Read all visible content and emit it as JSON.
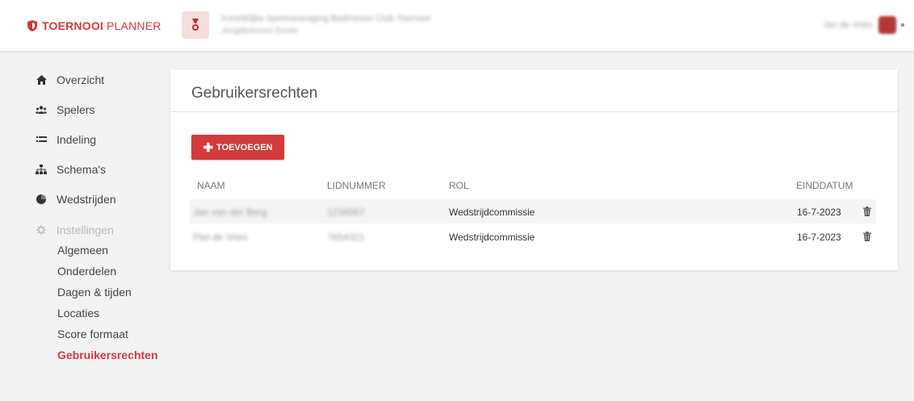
{
  "header": {
    "brand_bold": "TOERNOOI",
    "brand_light": "PLANNER",
    "org_line1": "Koninklijke Sportvereniging Badminton Club Toernooi",
    "org_line2": "Jeugdtoernooi Zomer",
    "user_name": "Jan de Vries"
  },
  "sidebar": {
    "items": [
      {
        "label": "Overzicht",
        "icon": "home-icon"
      },
      {
        "label": "Spelers",
        "icon": "users-icon"
      },
      {
        "label": "Indeling",
        "icon": "list-icon"
      },
      {
        "label": "Schema's",
        "icon": "sitemap-icon"
      },
      {
        "label": "Wedstrijden",
        "icon": "pie-icon"
      },
      {
        "label": "Instellingen",
        "icon": "gear-icon"
      }
    ],
    "sub_items": [
      {
        "label": "Algemeen"
      },
      {
        "label": "Onderdelen"
      },
      {
        "label": "Dagen & tijden"
      },
      {
        "label": "Locaties"
      },
      {
        "label": "Score formaat"
      },
      {
        "label": "Gebruikersrechten"
      }
    ]
  },
  "main": {
    "title": "Gebruikersrechten",
    "add_label": "TOEVOEGEN",
    "columns": {
      "naam": "NAAM",
      "lidnummer": "LIDNUMMER",
      "rol": "ROL",
      "einddatum": "EINDDATUM"
    },
    "rows": [
      {
        "naam": "Jan van der Berg",
        "lidnummer": "1234567",
        "rol": "Wedstrijdcommissie",
        "einddatum": "16-7-2023"
      },
      {
        "naam": "Piet de Vries",
        "lidnummer": "7654321",
        "rol": "Wedstrijdcommissie",
        "einddatum": "16-7-2023"
      }
    ]
  },
  "colors": {
    "accent": "#d33a3a",
    "background": "#f3f3f3"
  }
}
